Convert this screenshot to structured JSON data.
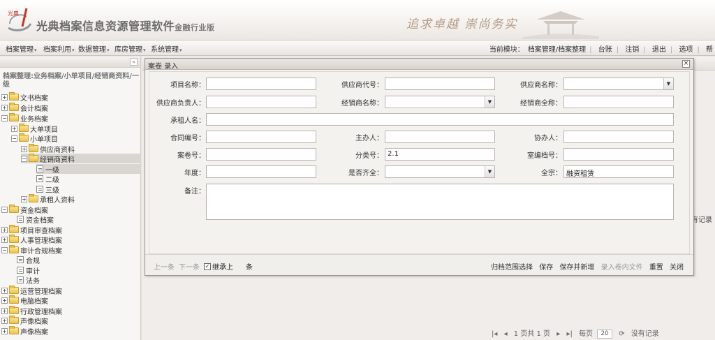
{
  "header": {
    "app_title": "光典档案信息资源管理软件",
    "edition": "金融行业版",
    "slogan": "追求卓越  崇尚务实",
    "logo_text": "光典"
  },
  "menubar": {
    "menus": [
      "档案管理",
      "档案利用",
      "数据管理",
      "库房管理",
      "系统管理"
    ],
    "current_module_label": "当前模块：",
    "current_module": "档案管理/档案整理",
    "links": [
      "台账",
      "注销",
      "退出",
      "选项",
      "帮"
    ]
  },
  "leftpanel": {
    "breadcrumb": "档案整理:业务档案/小单项目/经销商资料/一级",
    "tree": [
      {
        "label": "文书档案",
        "type": "folder",
        "exp": "+"
      },
      {
        "label": "会计档案",
        "type": "folder",
        "exp": "+"
      },
      {
        "label": "业务档案",
        "type": "folder",
        "exp": "-"
      },
      {
        "label": "大单项目",
        "type": "folder",
        "exp": "+"
      },
      {
        "label": "小单项目",
        "type": "folder",
        "exp": "-"
      },
      {
        "label": "供应商资料",
        "type": "folder",
        "exp": "+"
      },
      {
        "label": "经销商资料",
        "type": "folder",
        "exp": "-"
      },
      {
        "label": "一级",
        "type": "leaf"
      },
      {
        "label": "二级",
        "type": "leaf"
      },
      {
        "label": "三级",
        "type": "leaf"
      },
      {
        "label": "承租人资料",
        "type": "folder",
        "exp": "+"
      },
      {
        "label": "资金档案",
        "type": "folder",
        "exp": "-"
      },
      {
        "label": "资金档案",
        "type": "leaf"
      },
      {
        "label": "项目审查档案",
        "type": "folder",
        "exp": "+"
      },
      {
        "label": "人事管理档案",
        "type": "folder",
        "exp": "+"
      },
      {
        "label": "审计合规档案",
        "type": "folder",
        "exp": "-"
      },
      {
        "label": "合规",
        "type": "leaf"
      },
      {
        "label": "审计",
        "type": "leaf"
      },
      {
        "label": "法务",
        "type": "leaf"
      },
      {
        "label": "运营管理档案",
        "type": "folder",
        "exp": "+"
      },
      {
        "label": "电脑档案",
        "type": "folder",
        "exp": "+"
      },
      {
        "label": "行政管理档案",
        "type": "folder",
        "exp": "+"
      },
      {
        "label": "声像档案",
        "type": "folder",
        "exp": "+"
      },
      {
        "label": "声像档案",
        "type": "folder",
        "exp": "+"
      }
    ]
  },
  "dialog": {
    "title": "案卷 录入",
    "close": "×",
    "fields": {
      "project_name": {
        "label": "项目名称：",
        "value": ""
      },
      "supplier_code": {
        "label": "供应商代号：",
        "value": ""
      },
      "supplier_name": {
        "label": "供应商名称：",
        "value": ""
      },
      "supplier_contact": {
        "label": "供应商负责人：",
        "value": ""
      },
      "dealer_name": {
        "label": "经销商名称：",
        "value": ""
      },
      "dealer_full": {
        "label": "经销商全称：",
        "value": ""
      },
      "lessee": {
        "label": "承租人名：",
        "value": ""
      },
      "contract_no": {
        "label": "合同编号：",
        "value": ""
      },
      "handler": {
        "label": "主办人：",
        "value": ""
      },
      "assistant": {
        "label": "协办人：",
        "value": ""
      },
      "volume_no": {
        "label": "案卷号：",
        "value": ""
      },
      "class_no": {
        "label": "分类号：",
        "value": "2.1"
      },
      "archive_no": {
        "label": "室编档号：",
        "value": ""
      },
      "year": {
        "label": "年度：",
        "value": ""
      },
      "complete": {
        "label": "是否齐全：",
        "value": ""
      },
      "fonds": {
        "label": "全宗：",
        "value": "融资租赁"
      },
      "remarks": {
        "label": "备注：",
        "value": ""
      }
    },
    "footer_left": {
      "prev": "上一条",
      "next": "下一条",
      "continue_label": "继承上",
      "continue_suffix": "条",
      "checked": "✓"
    },
    "footer_right": [
      "归档范围选择",
      "保存",
      "保存并新增",
      "录入卷内文件",
      "重置",
      "关闭"
    ]
  },
  "pager": {
    "page_of": "1 页共 1 页",
    "per_page_label": "每页",
    "per_page": "20",
    "no_records": "没有记录",
    "side_text": "有记录"
  }
}
